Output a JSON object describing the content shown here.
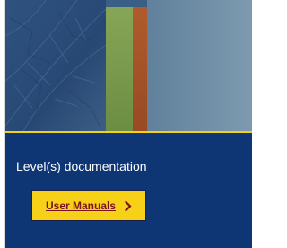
{
  "card": {
    "title": "Level(s) documentation",
    "cta_label": "User Manuals",
    "cta_icon": "chevron-right-icon"
  },
  "colors": {
    "card_background": "#0e3675",
    "banner_rule": "#f3d117",
    "button_background": "#f7d117",
    "button_text": "#7a1420",
    "stripe_green": "#7a9a4a",
    "stripe_orange": "#a8532a",
    "banner_leaf": "#2c4f7c",
    "banner_sky": "#6f8fa8"
  }
}
